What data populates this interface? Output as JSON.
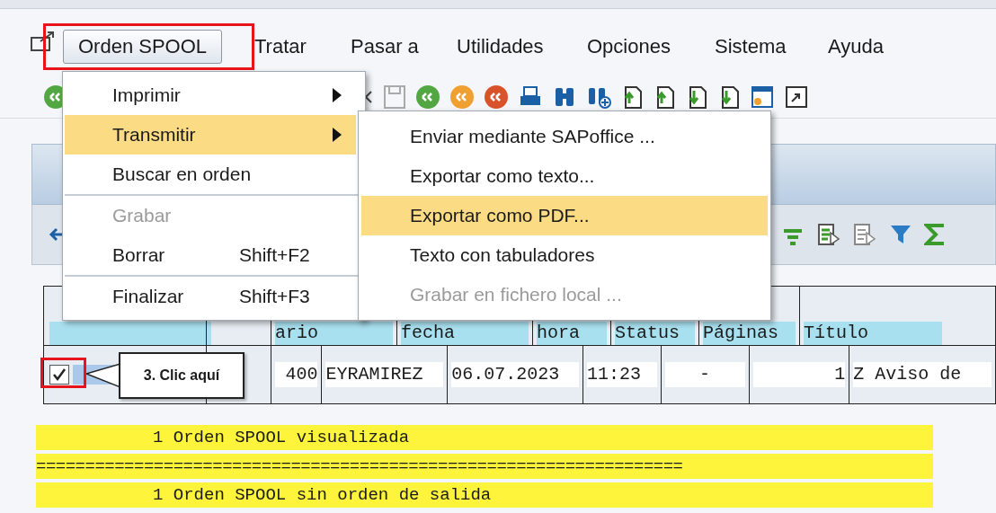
{
  "menu_bar": [
    {
      "label": "Orden SPOOL",
      "selected": true
    },
    {
      "label": "Tratar",
      "selected": false
    },
    {
      "label": "Pasar a",
      "selected": false
    },
    {
      "label": "Utilidades",
      "selected": false
    },
    {
      "label": "Opciones",
      "selected": false
    },
    {
      "label": "Sistema",
      "selected": false
    },
    {
      "label": "Ayuda",
      "selected": false
    }
  ],
  "menu": {
    "items": [
      {
        "label": "Imprimir",
        "submenu": true,
        "selected": false,
        "disabled": false,
        "divider_before": false
      },
      {
        "label": "Transmitir",
        "submenu": true,
        "selected": true,
        "disabled": false,
        "divider_before": false
      },
      {
        "label": "Buscar en orden",
        "submenu": false,
        "selected": false,
        "disabled": false,
        "divider_before": false
      },
      {
        "label": "Grabar",
        "submenu": false,
        "selected": false,
        "disabled": true,
        "divider_before": true
      },
      {
        "label": "Borrar",
        "shortcut": "Shift+F2",
        "submenu": false,
        "selected": false,
        "disabled": false,
        "divider_before": false
      },
      {
        "label": "Finalizar",
        "shortcut": "Shift+F3",
        "submenu": false,
        "selected": false,
        "disabled": false,
        "divider_before": true
      }
    ]
  },
  "submenu": {
    "items": [
      {
        "label": "Enviar mediante SAPoffice ...",
        "selected": false,
        "disabled": false
      },
      {
        "label": "Exportar como texto...",
        "selected": false,
        "disabled": false
      },
      {
        "label": "Exportar como PDF...",
        "selected": true,
        "disabled": false
      },
      {
        "label": "Texto con tabuladores",
        "selected": false,
        "disabled": false
      },
      {
        "label": "Grabar en fichero local ...",
        "selected": false,
        "disabled": true
      }
    ]
  },
  "table": {
    "columns": [
      "ario",
      "fecha",
      "hora",
      "Status",
      "Páginas",
      "Título"
    ],
    "rows": [
      {
        "checked": true,
        "cells": [
          "400",
          "EYRAMIREZ",
          "06.07.2023",
          "11:23",
          "-",
          "1",
          "Z Aviso de"
        ]
      }
    ]
  },
  "messages": [
    {
      "kind": "text",
      "text": "1 Orden SPOOL visualizada"
    },
    {
      "kind": "rule",
      "text": "=================================================================="
    },
    {
      "kind": "text",
      "text": "1 Orden SPOOL sin orden de salida"
    }
  ],
  "callout": {
    "text": "3. Clic aquí"
  }
}
